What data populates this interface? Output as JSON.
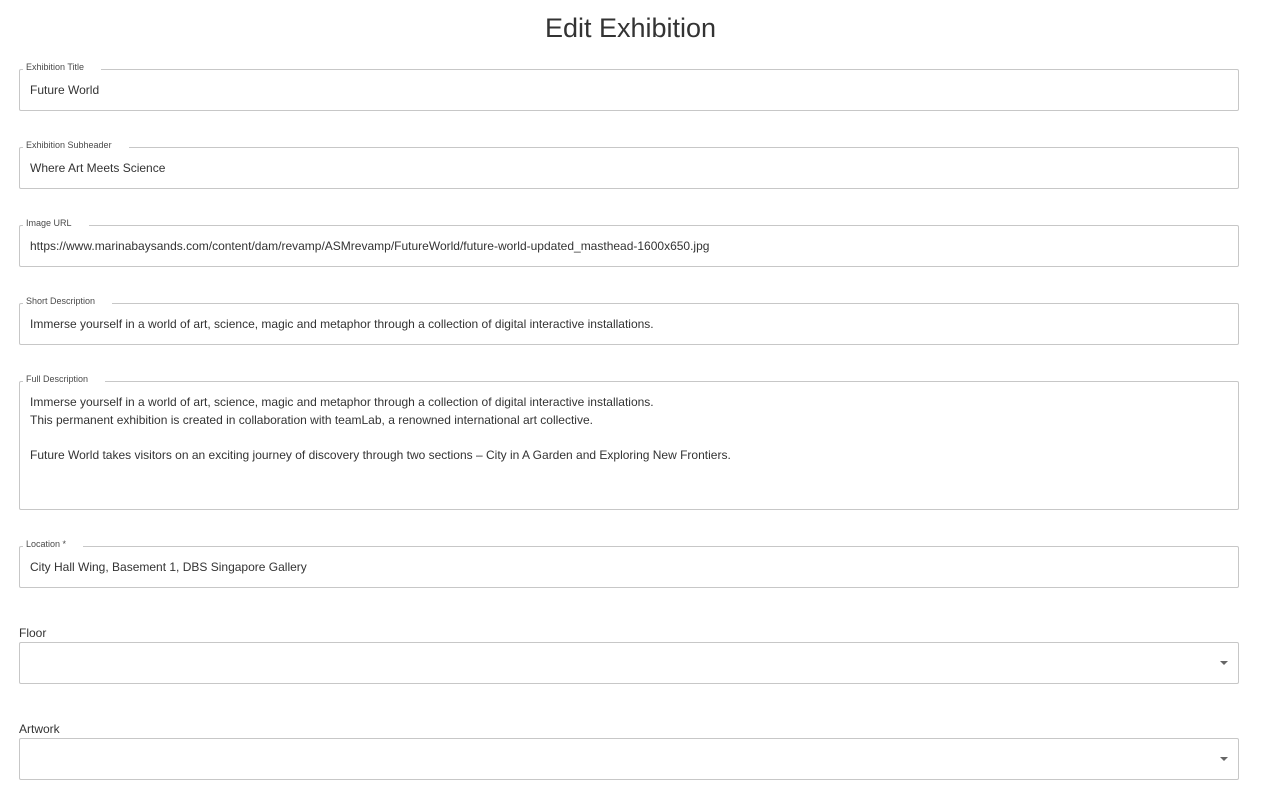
{
  "page": {
    "title": "Edit Exhibition"
  },
  "fields": {
    "title": {
      "label": "Exhibition Title",
      "value": "Future World"
    },
    "subheader": {
      "label": "Exhibition Subheader",
      "value": "Where Art Meets Science"
    },
    "image_url": {
      "label": "Image URL",
      "value": "https://www.marinabaysands.com/content/dam/revamp/ASMrevamp/FutureWorld/future-world-updated_masthead-1600x650.jpg"
    },
    "short_description": {
      "label": "Short Description",
      "value": "Immerse yourself in a world of art, science, magic and metaphor through a collection of digital interactive installations."
    },
    "full_description": {
      "label": "Full Description",
      "value": "Immerse yourself in a world of art, science, magic and metaphor through a collection of digital interactive installations.\nThis permanent exhibition is created in collaboration with teamLab, a renowned international art collective.\n\nFuture World  takes visitors on an exciting journey of discovery through two sections – City in A Garden and Exploring New Frontiers."
    },
    "location": {
      "label": "Location *",
      "value": "City Hall Wing, Basement 1, DBS Singapore Gallery"
    },
    "floor": {
      "label": "Floor",
      "value": ""
    },
    "artwork": {
      "label": "Artwork",
      "value": ""
    }
  },
  "icons": {
    "dropdown": "caret-down-icon"
  }
}
